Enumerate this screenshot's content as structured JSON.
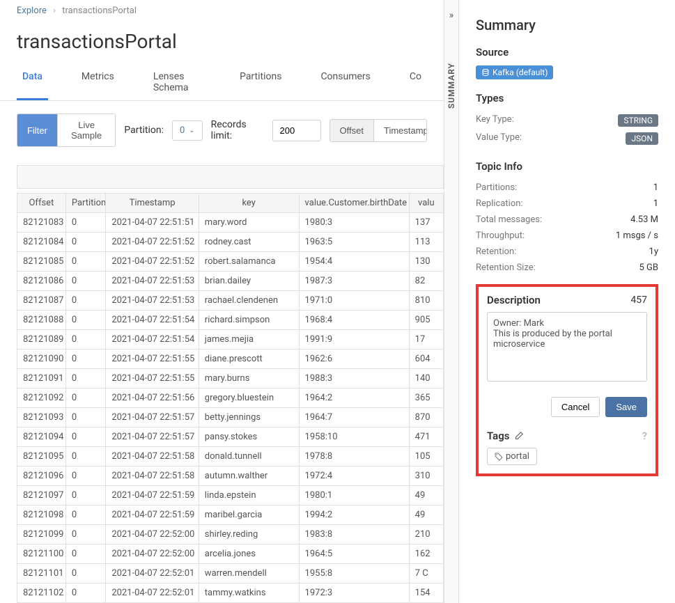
{
  "breadcrumb": {
    "root": "Explore",
    "current": "transactionsPortal"
  },
  "title": "transactionsPortal",
  "tabs": [
    "Data",
    "Metrics",
    "Lenses Schema",
    "Partitions",
    "Consumers",
    "Co"
  ],
  "active_tab": 0,
  "toolbar": {
    "filter": "Filter",
    "live": "Live Sample",
    "partition_label": "Partition:",
    "partition_value": "0",
    "records_label": "Records limit:",
    "records_value": "200",
    "offset": "Offset",
    "timestamp": "Timestamp"
  },
  "summary_tab": "SUMMARY",
  "table": {
    "columns": [
      "Offset",
      "Partition",
      "Timestamp",
      "key",
      "value.Customer.birthDate",
      "valu"
    ],
    "rows": [
      [
        "82121083",
        "0",
        "2021-04-07 22:51:51",
        "mary.word",
        "1980:3",
        "137"
      ],
      [
        "82121084",
        "0",
        "2021-04-07 22:51:52",
        "rodney.cast",
        "1963:5",
        "113"
      ],
      [
        "82121085",
        "0",
        "2021-04-07 22:51:52",
        "robert.salamanca",
        "1954:4",
        "130"
      ],
      [
        "82121086",
        "0",
        "2021-04-07 22:51:53",
        "brian.dailey",
        "1987:3",
        "82 "
      ],
      [
        "82121087",
        "0",
        "2021-04-07 22:51:53",
        "rachael.clendenen",
        "1971:0",
        "810"
      ],
      [
        "82121088",
        "0",
        "2021-04-07 22:51:54",
        "richard.simpson",
        "1968:4",
        "905"
      ],
      [
        "82121089",
        "0",
        "2021-04-07 22:51:54",
        "james.mejia",
        "1991:9",
        "17 "
      ],
      [
        "82121090",
        "0",
        "2021-04-07 22:51:55",
        "diane.prescott",
        "1962:6",
        "604"
      ],
      [
        "82121091",
        "0",
        "2021-04-07 22:51:55",
        "mary.burns",
        "1988:3",
        "140"
      ],
      [
        "82121092",
        "0",
        "2021-04-07 22:51:56",
        "gregory.bluestein",
        "1964:2",
        "365"
      ],
      [
        "82121093",
        "0",
        "2021-04-07 22:51:57",
        "betty.jennings",
        "1964:7",
        "870"
      ],
      [
        "82121094",
        "0",
        "2021-04-07 22:51:57",
        "pansy.stokes",
        "1958:10",
        "471"
      ],
      [
        "82121095",
        "0",
        "2021-04-07 22:51:58",
        "donald.tunnell",
        "1978:8",
        "105"
      ],
      [
        "82121096",
        "0",
        "2021-04-07 22:51:58",
        "autumn.walther",
        "1972:4",
        "310"
      ],
      [
        "82121097",
        "0",
        "2021-04-07 22:51:59",
        "linda.epstein",
        "1980:1",
        "49 "
      ],
      [
        "82121098",
        "0",
        "2021-04-07 22:51:59",
        "maribel.garcia",
        "1994:2",
        "49 "
      ],
      [
        "82121099",
        "0",
        "2021-04-07 22:52:00",
        "shirley.reding",
        "1983:8",
        "210"
      ],
      [
        "82121100",
        "0",
        "2021-04-07 22:52:00",
        "arcelia.jones",
        "1964:5",
        "162"
      ],
      [
        "82121101",
        "0",
        "2021-04-07 22:52:01",
        "warren.mendell",
        "1955:8",
        "7 C"
      ],
      [
        "82121102",
        "0",
        "2021-04-07 22:52:01",
        "tammy.watkins",
        "1972:3",
        "154"
      ]
    ]
  },
  "summary": {
    "heading": "Summary",
    "source_label": "Source",
    "source_value": "Kafka (default)",
    "types_label": "Types",
    "key_type_label": "Key Type:",
    "key_type_value": "STRING",
    "value_type_label": "Value Type:",
    "value_type_value": "JSON",
    "topic_info_label": "Topic Info",
    "info": [
      {
        "k": "Partitions:",
        "v": "1"
      },
      {
        "k": "Replication:",
        "v": "1"
      },
      {
        "k": "Total messages:",
        "v": "4.53 M"
      },
      {
        "k": "Throughput:",
        "v": "1 msgs / s"
      },
      {
        "k": "Retention:",
        "v": "1y"
      },
      {
        "k": "Retention Size:",
        "v": "5 GB"
      }
    ],
    "description_label": "Description",
    "description_count": "457",
    "description_text": "Owner: Mark\nThis is produced by the portal microservice",
    "cancel": "Cancel",
    "save": "Save",
    "tags_label": "Tags",
    "tag": "portal"
  }
}
